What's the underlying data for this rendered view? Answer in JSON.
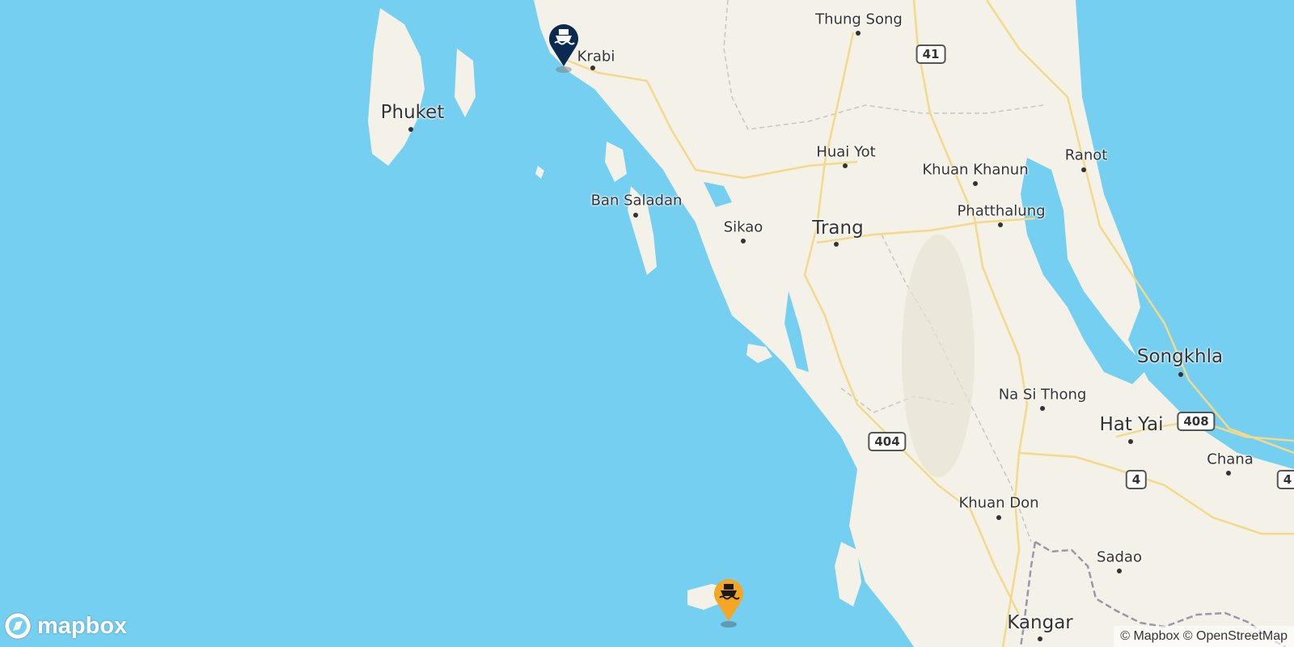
{
  "colors": {
    "sea": "#75cff0",
    "land": "#f4f1e8",
    "road": "#f3d98a",
    "border": "#9a98a8",
    "destination_pin": "#0b2a50",
    "origin_pin": "#f5a623"
  },
  "places": {
    "phuket": "Phuket",
    "krabi": "Krabi",
    "thung_song": "Thung Song",
    "huai_yot": "Huai Yot",
    "khuan_khanun": "Khuan Khanun",
    "ranot": "Ranot",
    "ban_saladan": "Ban Saladan",
    "sikao": "Sikao",
    "trang": "Trang",
    "phatthalung": "Phatthalung",
    "songkhla": "Songkhla",
    "na_si_thong": "Na Si Thong",
    "hat_yai": "Hat Yai",
    "chana": "Chana",
    "khuan_don": "Khuan Don",
    "sadao": "Sadao",
    "kangar": "Kangar"
  },
  "road_shields": {
    "r41": "41",
    "r404": "404",
    "r408": "408",
    "r4": "4",
    "r4_edge": "4"
  },
  "markers": {
    "destination": {
      "icon": "ferry-icon",
      "label": "destination port Krabi"
    },
    "origin": {
      "icon": "ferry-icon",
      "label": "departure port"
    }
  },
  "logo": {
    "text": "mapbox",
    "icon": "mapbox-compass-icon"
  },
  "attribution": "© Mapbox © OpenStreetMap"
}
